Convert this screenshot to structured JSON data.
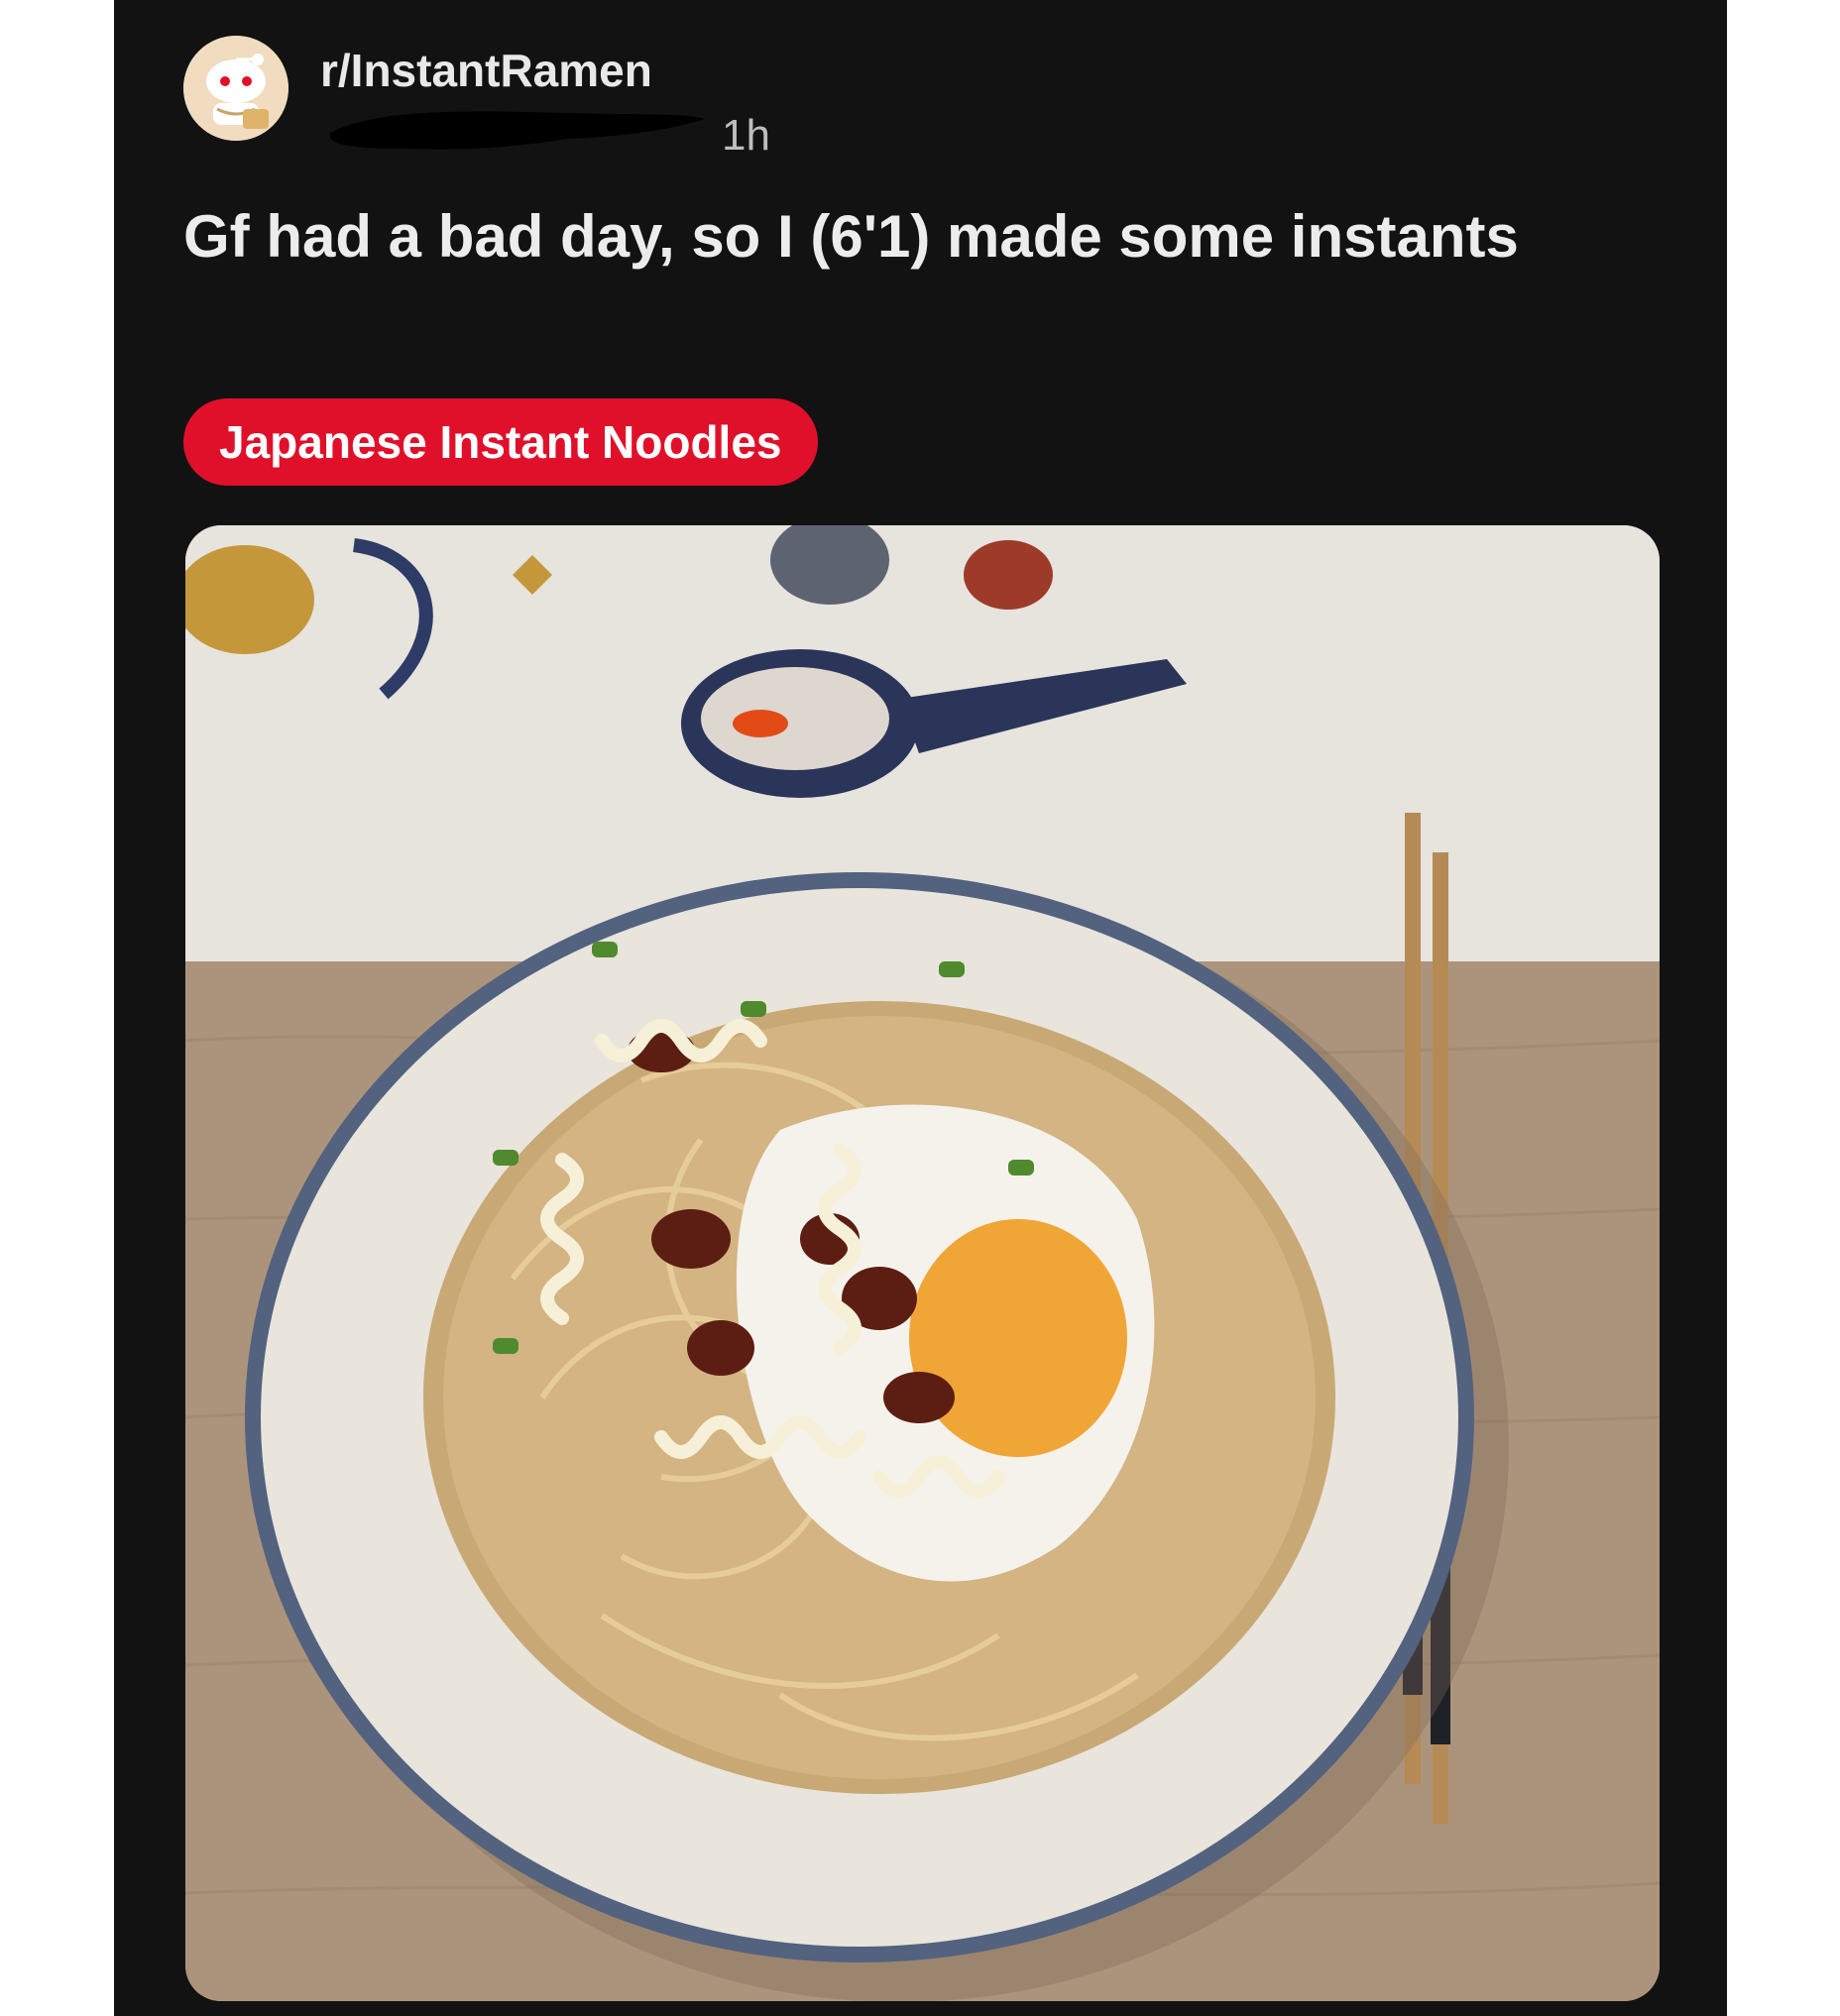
{
  "post": {
    "subreddit": "r/InstantRamen",
    "age": "1h",
    "title": "Gf had a bad day, so I (6'1) made some instants",
    "flair": "Japanese Instant Noodles",
    "image": {
      "description_icon": "ramen-photo",
      "subject": "bowl of instant noodles with fried egg, mayo, chili oil and scallions"
    }
  },
  "colors": {
    "background": "#121212",
    "text": "#ececec",
    "flair_bg": "#e0102b",
    "flair_text": "#ffffff",
    "page_border": "#ffffff"
  },
  "icons": {
    "avatar": "reddit-snoo-ramen-avatar"
  }
}
